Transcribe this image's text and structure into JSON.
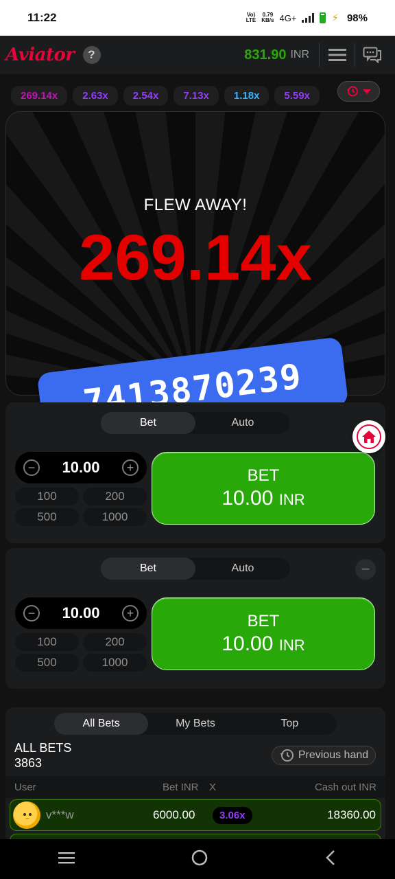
{
  "status_bar": {
    "time": "11:22",
    "volte": "Vo)\nLTE",
    "speed": "0.79\nKB/s",
    "network": "4G+",
    "battery": "98%"
  },
  "header": {
    "logo": "Aviator",
    "help_icon": "?",
    "balance": "831.90",
    "currency": "INR",
    "menu_icon": "hamburger-menu-icon",
    "chat_icon": "chat-icon"
  },
  "history": {
    "multipliers": [
      {
        "value": "269.14x",
        "color": "#c017b4"
      },
      {
        "value": "2.63x",
        "color": "#913ef8"
      },
      {
        "value": "2.54x",
        "color": "#913ef8"
      },
      {
        "value": "7.13x",
        "color": "#913ef8"
      },
      {
        "value": "1.18x",
        "color": "#34b4ff"
      },
      {
        "value": "5.59x",
        "color": "#913ef8"
      }
    ],
    "history_icon": "history-clock-icon"
  },
  "game": {
    "status": "FLEW AWAY!",
    "multiplier": "269.14x"
  },
  "overlay": {
    "phone_text": "7413870239"
  },
  "bet_panels": [
    {
      "tabs": [
        "Bet",
        "Auto"
      ],
      "active_tab": "Bet",
      "amount": "10.00",
      "quick_amounts": [
        "100",
        "200",
        "500",
        "1000"
      ],
      "button_label": "BET",
      "button_amount": "10.00",
      "button_currency": "INR"
    },
    {
      "tabs": [
        "Bet",
        "Auto"
      ],
      "active_tab": "Bet",
      "amount": "10.00",
      "quick_amounts": [
        "100",
        "200",
        "500",
        "1000"
      ],
      "button_label": "BET",
      "button_amount": "10.00",
      "button_currency": "INR"
    }
  ],
  "bets": {
    "tabs": [
      "All Bets",
      "My Bets",
      "Top"
    ],
    "active_tab": "All Bets",
    "title": "ALL BETS",
    "count": "3863",
    "previous_hand": "Previous hand",
    "columns": [
      "User",
      "Bet INR",
      "X",
      "Cash out INR"
    ],
    "rows": [
      {
        "user": "v***w",
        "bet": "6000.00",
        "x": "3.06x",
        "cashout": "18360.00"
      }
    ]
  },
  "colors": {
    "brand_red": "#e50539",
    "green": "#28a909",
    "overlay_blue": "#3b6cf0"
  }
}
